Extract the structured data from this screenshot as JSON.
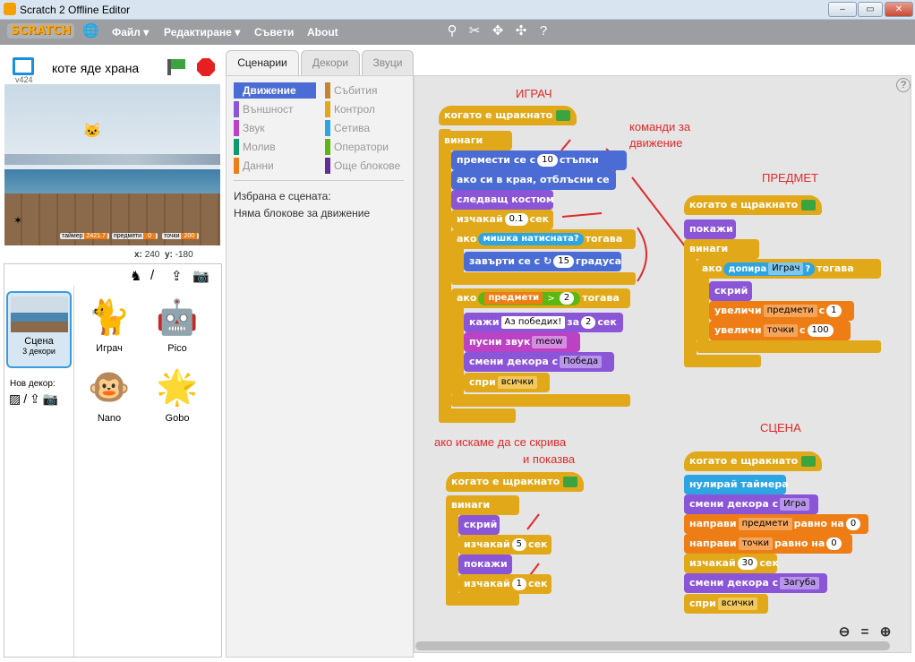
{
  "window": {
    "title": "Scratch 2 Offline Editor",
    "min": "–",
    "max": "▭",
    "close": "✕"
  },
  "menu": {
    "logo": "SCRATCH",
    "file": "Файл ▾",
    "edit": "Редактиране ▾",
    "tips": "Съвети",
    "about": "About"
  },
  "stage": {
    "project_name": "коте яде храна",
    "version": "v424",
    "x_label": "x:",
    "x": "240",
    "y_label": "y:",
    "y": "-180",
    "hud": {
      "timer_label": "таймер",
      "timer": "2421.7",
      "items_label": "предмети",
      "items": "0",
      "points_label": "точки",
      "points": "200"
    }
  },
  "sprites_panel": {
    "scene_label": "Сцена",
    "scene_sub": "3 декори",
    "new_backdrop": "Нов декор:",
    "sprites": [
      {
        "name": "Играч"
      },
      {
        "name": "Pico"
      },
      {
        "name": "Nano"
      },
      {
        "name": "Gobo"
      }
    ]
  },
  "tabs": {
    "scripts": "Сценарии",
    "costumes": "Декори",
    "sounds": "Звуци"
  },
  "categories": {
    "motion": "Движение",
    "looks": "Външност",
    "sound": "Звук",
    "pen": "Молив",
    "data": "Данни",
    "events": "Събития",
    "control": "Контрол",
    "sensing": "Сетива",
    "operators": "Оператори",
    "more": "Още блокове"
  },
  "palette_msg": {
    "line1": "Избрана е сцената:",
    "line2": "Няма блокове за движение"
  },
  "notes": {
    "player": "ИГРАЧ",
    "motion": "команди за",
    "motion2": "движение",
    "item": "ПРЕДМЕТ",
    "scene": "СЦЕНА",
    "hide1": "ако искаме да се скрива",
    "hide2": "и показва"
  },
  "s1": {
    "hat": "когато е щракнато",
    "forever": "винаги",
    "move": "премести се с",
    "move_n": "10",
    "steps": "стъпки",
    "bounce": "ако си в края, отблъсни се",
    "next": "следващ костюм",
    "wait": "изчакай",
    "wait_n": "0.1",
    "sec": "сек",
    "if": "ако",
    "mouse": "мишка натисната?",
    "then": "тогава",
    "turn": "завърти се с",
    "turn_n": "15",
    "deg": "градуса",
    "if2": "ако",
    "var": "предмети",
    "gt": ">",
    "two": "2",
    "then2": "тогава",
    "say": "кажи",
    "say_t": "Аз победих!",
    "for": "за",
    "say_n": "2",
    "sec2": "сек",
    "play": "пусни звук",
    "sound": "meow",
    "switch": "смени декора с",
    "backdrop": "Победа",
    "stop": "спри",
    "stop_o": "всички"
  },
  "s2": {
    "hat": "когато е щракнато",
    "show": "покажи",
    "forever": "винаги",
    "if": "ако",
    "touch": "допира",
    "touch_o": "Играч",
    "q": "?",
    "then": "тогава",
    "hide": "скрий",
    "inc": "увеличи",
    "var1": "предмети",
    "by": "с",
    "n1": "1",
    "var2": "точки",
    "n2": "100"
  },
  "s3": {
    "hat": "когато е щракнато",
    "forever": "винаги",
    "hide": "скрий",
    "wait": "изчакай",
    "n1": "5",
    "sec": "сек",
    "show": "покажи",
    "n2": "1"
  },
  "s4": {
    "hat": "когато е щракнато",
    "reset": "нулирай таймера",
    "switch": "смени декора с",
    "bd": "Игра",
    "set": "направи",
    "var1": "предмети",
    "eq": "равно на",
    "v1": "0",
    "var2": "точки",
    "v2": "0",
    "wait": "изчакай",
    "n": "30",
    "sec": "сек",
    "bd2": "Загуба",
    "stop": "спри",
    "stop_o": "всички"
  }
}
